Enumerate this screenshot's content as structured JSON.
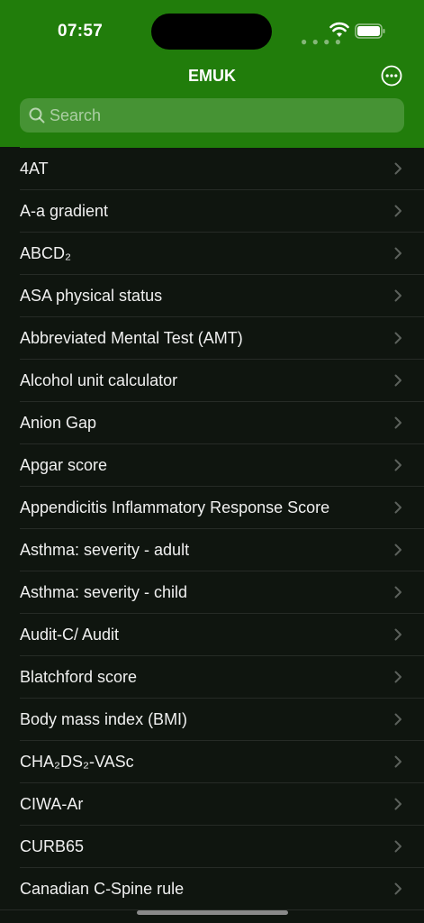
{
  "status": {
    "time": "07:57"
  },
  "header": {
    "title": "EMUK"
  },
  "search": {
    "placeholder": "Search"
  },
  "items": [
    "4AT",
    "A-a gradient",
    "ABCD₂",
    "ASA physical status",
    "Abbreviated Mental Test (AMT)",
    "Alcohol unit calculator",
    "Anion Gap",
    "Apgar score",
    "Appendicitis Inflammatory Response Score",
    "Asthma: severity - adult",
    "Asthma: severity - child",
    "Audit-C/ Audit",
    "Blatchford score",
    "Body mass index (BMI)",
    "CHA₂DS₂-VASc",
    "CIWA-Ar",
    "CURB65",
    "Canadian C-Spine rule"
  ],
  "colors": {
    "header": "#217d0b",
    "background": "#0f150f",
    "separator": "#262b26"
  }
}
